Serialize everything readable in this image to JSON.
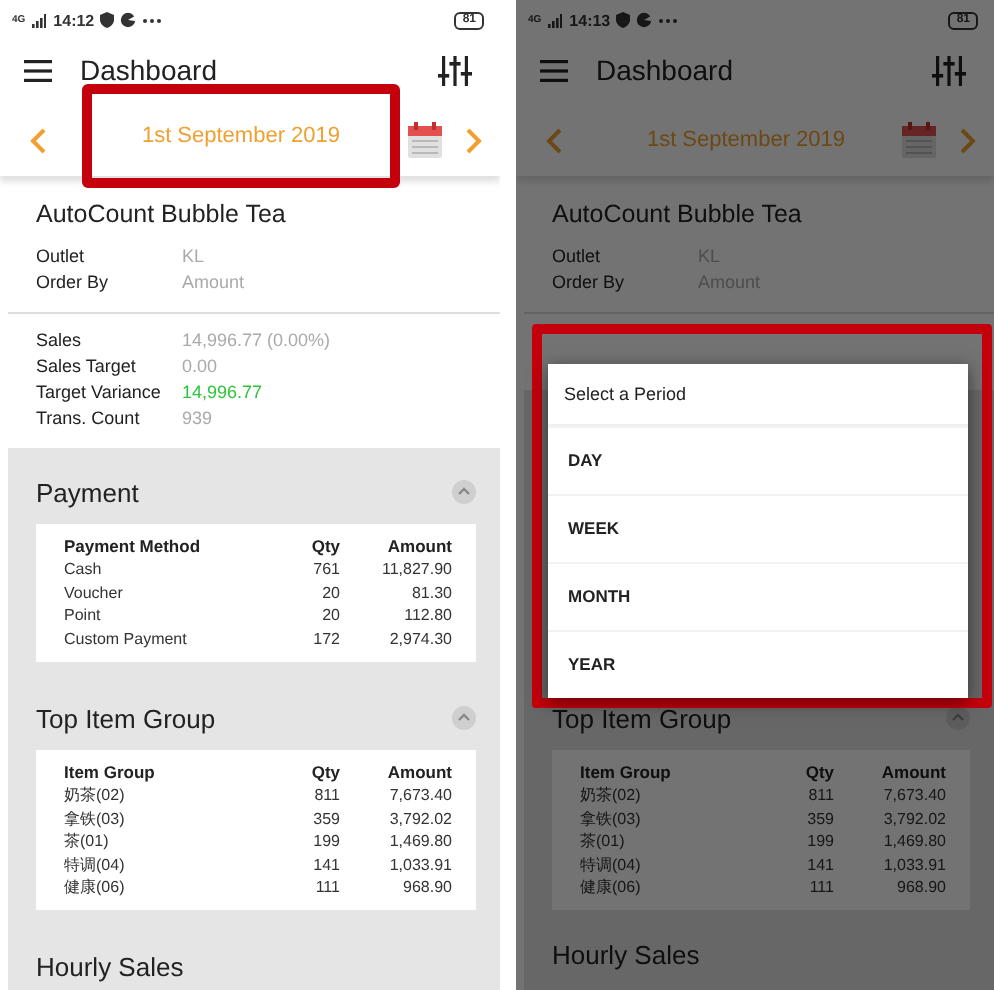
{
  "screens": [
    {
      "status_bar": {
        "network": "4G",
        "time": "14:12",
        "battery": "81"
      },
      "header": {
        "title": "Dashboard"
      },
      "date_bar": {
        "date": "1st September 2019",
        "highlighted": true
      },
      "company": "AutoCount Bubble Tea",
      "info": [
        {
          "label": "Outlet",
          "value": "KL"
        },
        {
          "label": "Order By",
          "value": "Amount"
        }
      ],
      "stats": [
        {
          "label": "Sales",
          "value": "14,996.77 (0.00%)",
          "positive": false
        },
        {
          "label": "Sales Target",
          "value": "0.00",
          "positive": false
        },
        {
          "label": "Target Variance",
          "value": "14,996.77",
          "positive": true
        },
        {
          "label": "Trans. Count",
          "value": "939",
          "positive": false
        }
      ],
      "sections": [
        {
          "title": "Payment",
          "expanded": true,
          "table": {
            "columns": [
              "Payment Method",
              "Qty",
              "Amount"
            ],
            "rows": [
              [
                "Cash",
                "761",
                "11,827.90"
              ],
              [
                "Voucher",
                "20",
                "81.30"
              ],
              [
                "Point",
                "20",
                "112.80"
              ],
              [
                "Custom Payment",
                "172",
                "2,974.30"
              ]
            ]
          }
        },
        {
          "title": "Top Item Group",
          "expanded": true,
          "table": {
            "columns": [
              "Item Group",
              "Qty",
              "Amount"
            ],
            "rows": [
              [
                "奶茶(02)",
                "811",
                "7,673.40"
              ],
              [
                "拿铁(03)",
                "359",
                "3,792.02"
              ],
              [
                "茶(01)",
                "199",
                "1,469.80"
              ],
              [
                "特调(04)",
                "141",
                "1,033.91"
              ],
              [
                "健康(06)",
                "111",
                "968.90"
              ]
            ]
          }
        },
        {
          "title": "Hourly Sales"
        }
      ]
    },
    {
      "status_bar": {
        "network": "4G",
        "time": "14:13",
        "battery": "81"
      },
      "header": {
        "title": "Dashboard"
      },
      "date_bar": {
        "date": "1st September 2019",
        "highlighted": false
      },
      "company": "AutoCount Bubble Tea",
      "info": [
        {
          "label": "Outlet",
          "value": "KL"
        },
        {
          "label": "Order By",
          "value": "Amount"
        }
      ],
      "sections": [
        {
          "title": "Top Item Group",
          "expanded": true,
          "table": {
            "columns": [
              "Item Group",
              "Qty",
              "Amount"
            ],
            "rows": [
              [
                "奶茶(02)",
                "811",
                "7,673.40"
              ],
              [
                "拿铁(03)",
                "359",
                "3,792.02"
              ],
              [
                "茶(01)",
                "199",
                "1,469.80"
              ],
              [
                "特调(04)",
                "141",
                "1,033.91"
              ],
              [
                "健康(06)",
                "111",
                "968.90"
              ]
            ]
          }
        },
        {
          "title": "Hourly Sales"
        }
      ],
      "dialog": {
        "title": "Select a Period",
        "highlighted": true,
        "options": [
          {
            "label": "DAY",
            "selected": false
          },
          {
            "label": "WEEK",
            "selected": false
          },
          {
            "label": "MONTH",
            "selected": false
          },
          {
            "label": "YEAR",
            "selected": false
          }
        ]
      }
    }
  ]
}
